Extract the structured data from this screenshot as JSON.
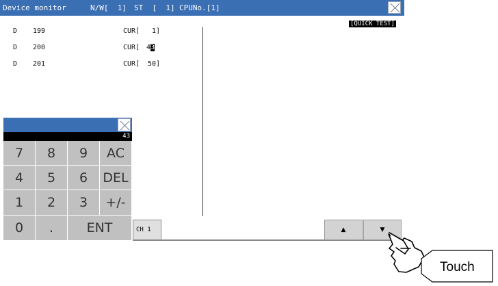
{
  "titlebar": {
    "title": "Device monitor",
    "nw": "N/W[  1]",
    "st": "ST  [  1]",
    "cpuno": "CPUNo.[1]"
  },
  "quick_test": "[QUICK TEST]",
  "devices": [
    {
      "dev": "D",
      "num": "199",
      "cur": "CUR[",
      "val": "1]"
    },
    {
      "dev": "D",
      "num": "200",
      "cur": "CUR[",
      "val_pre": "4",
      "val_cursor": "3",
      "val": ""
    },
    {
      "dev": "D",
      "num": "201",
      "cur": "CUR[",
      "val": "50]"
    }
  ],
  "keypad": {
    "display": "43",
    "keys": [
      "7",
      "8",
      "9",
      "AC",
      "4",
      "5",
      "6",
      "DEL",
      "1",
      "2",
      "3",
      "+/-",
      "0",
      ".",
      "ENT"
    ]
  },
  "channel_tab": "CH 1",
  "nav": {
    "up": "▲",
    "down": "▼"
  },
  "callout": "Touch",
  "colors": {
    "titlebar": "#3b6fb4",
    "key": "#c0c0c0"
  }
}
